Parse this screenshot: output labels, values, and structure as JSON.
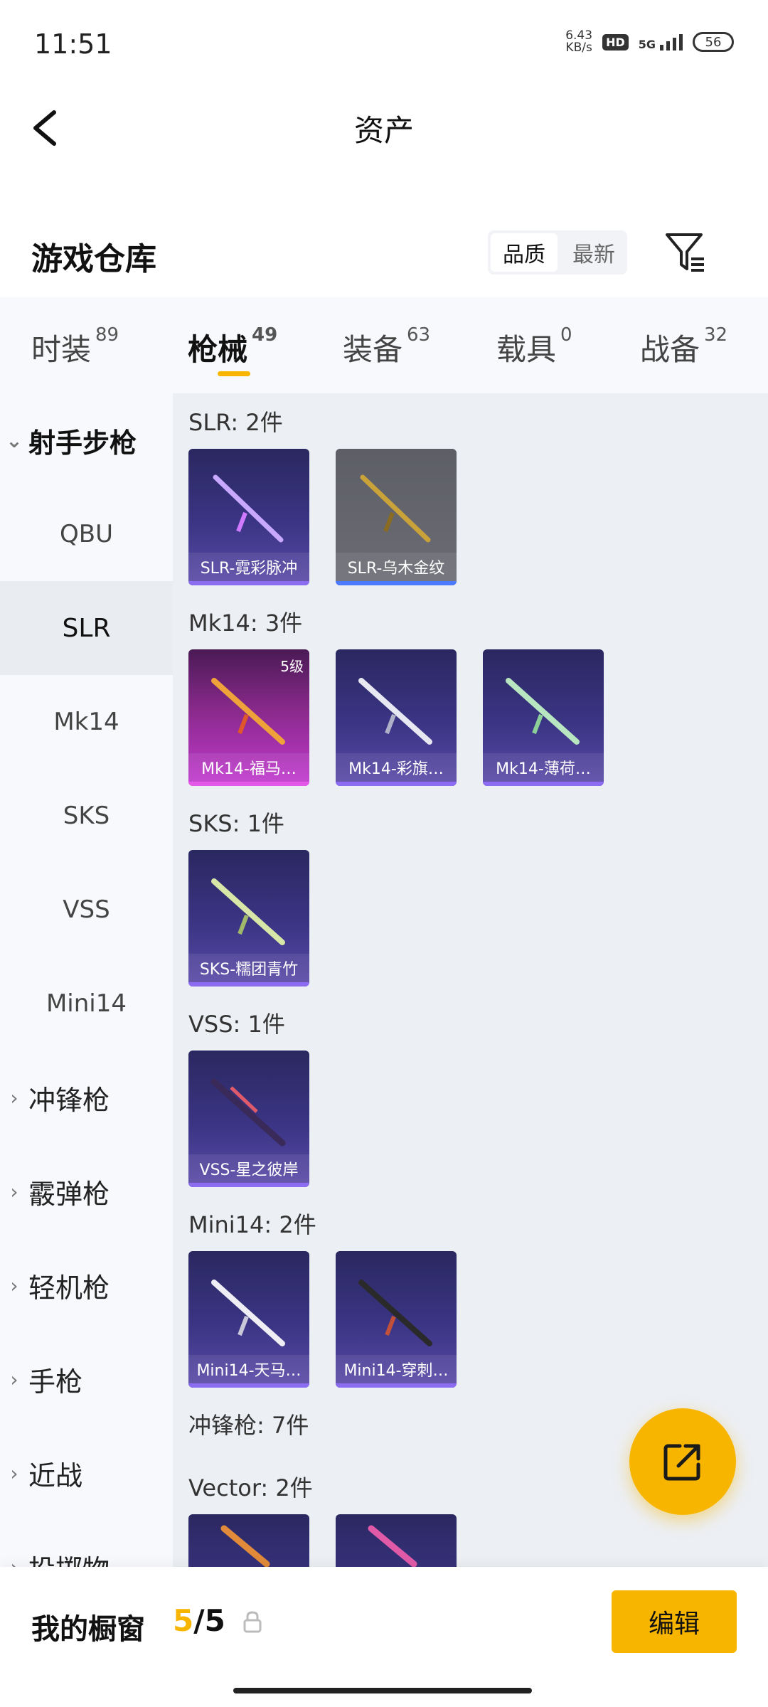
{
  "status": {
    "time": "11:51",
    "net_speed_value": "6.43",
    "net_speed_unit": "KB/s",
    "hd": "HD",
    "signal": "5G",
    "battery": "56"
  },
  "header": {
    "title": "资产"
  },
  "warehouse": {
    "title": "游戏仓库",
    "sort_options": [
      "品质",
      "最新"
    ],
    "sort_selected": "品质"
  },
  "tabs": [
    {
      "label": "时装",
      "count": "89"
    },
    {
      "label": "枪械",
      "count": "49",
      "active": true
    },
    {
      "label": "装备",
      "count": "63"
    },
    {
      "label": "载具",
      "count": "0"
    },
    {
      "label": "战备",
      "count": "32"
    }
  ],
  "sidebar": {
    "open_group": "射手步枪",
    "sub_items": [
      "QBU",
      "SLR",
      "Mk14",
      "SKS",
      "VSS",
      "Mini14"
    ],
    "selected": "SLR",
    "groups": [
      "冲锋枪",
      "霰弹枪",
      "轻机枪",
      "手枪",
      "近战",
      "投掷物"
    ]
  },
  "sections": [
    {
      "title": "SLR: 2件",
      "items": [
        {
          "name": "SLR-霓彩脉冲",
          "rarity": "purple"
        },
        {
          "name": "SLR-乌木金纹",
          "rarity": "blue"
        }
      ]
    },
    {
      "title": "Mk14: 3件",
      "items": [
        {
          "name": "Mk14-福马…",
          "rarity": "pink",
          "level": "5级"
        },
        {
          "name": "Mk14-彩旗…",
          "rarity": "purple"
        },
        {
          "name": "Mk14-薄荷…",
          "rarity": "purple"
        }
      ]
    },
    {
      "title": "SKS: 1件",
      "items": [
        {
          "name": "SKS-糯团青竹",
          "rarity": "purple"
        }
      ]
    },
    {
      "title": "VSS: 1件",
      "items": [
        {
          "name": "VSS-星之彼岸",
          "rarity": "purple"
        }
      ]
    },
    {
      "title": "Mini14: 2件",
      "items": [
        {
          "name": "Mini14-天马…",
          "rarity": "purple"
        },
        {
          "name": "Mini14-穿刺…",
          "rarity": "purple"
        }
      ]
    },
    {
      "title": "冲锋枪: 7件",
      "items": []
    },
    {
      "title": "Vector: 2件",
      "items": [
        {
          "name": "",
          "rarity": "purple"
        },
        {
          "name": "",
          "rarity": "purple"
        }
      ]
    }
  ],
  "showcase": {
    "title": "我的橱窗",
    "current": "5",
    "separator": "/",
    "total": "5",
    "edit_label": "编辑"
  },
  "colors": {
    "accent": "#f7b500",
    "purple_card": "#3b3585",
    "pink_card": "#c23ad0",
    "grey_card": "#6c6d74"
  }
}
